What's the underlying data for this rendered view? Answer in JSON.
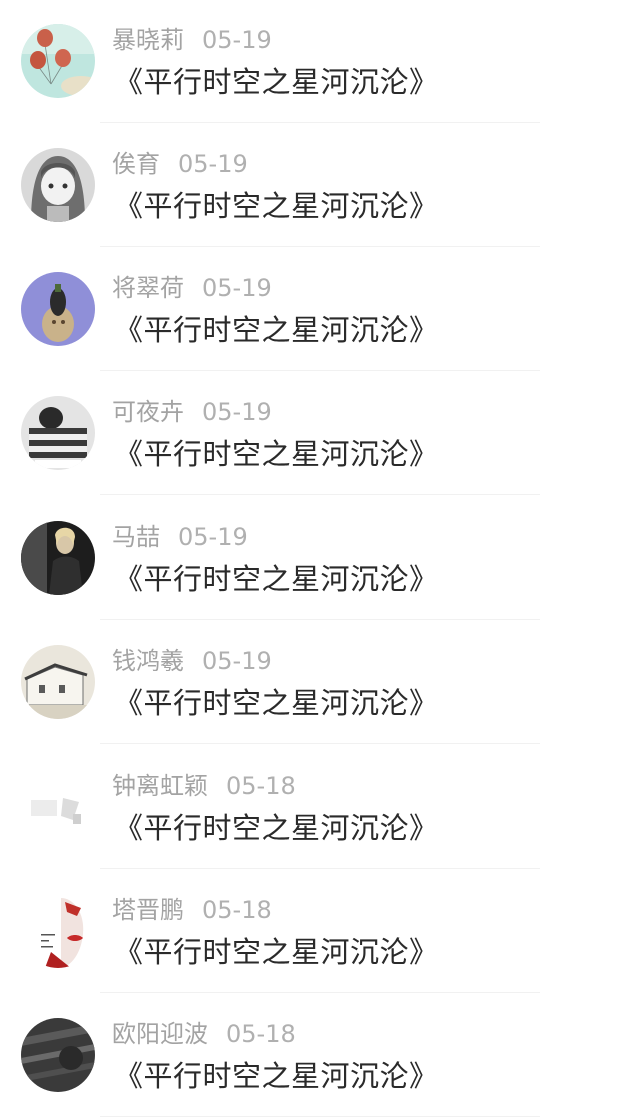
{
  "comments": [
    {
      "name": "暴晓莉",
      "date": "05-19",
      "title": "《平行时空之星河沉沦》",
      "avatar": "balloons-avatar"
    },
    {
      "name": "俟育",
      "date": "05-19",
      "title": "《平行时空之星河沉沦》",
      "avatar": "anime-girl-avatar"
    },
    {
      "name": "将翠荷",
      "date": "05-19",
      "title": "《平行时空之星河沉沦》",
      "avatar": "eggplant-avatar"
    },
    {
      "name": "可夜卉",
      "date": "05-19",
      "title": "《平行时空之星河沉沦》",
      "avatar": "striped-sweater-avatar"
    },
    {
      "name": "马喆",
      "date": "05-19",
      "title": "《平行时空之星河沉沦》",
      "avatar": "dark-portrait-avatar"
    },
    {
      "name": "钱鸿羲",
      "date": "05-19",
      "title": "《平行时空之星河沉沦》",
      "avatar": "building-avatar"
    },
    {
      "name": "钟离虹颖",
      "date": "05-18",
      "title": "《平行时空之星河沉沦》",
      "avatar": "light-abstract-avatar"
    },
    {
      "name": "塔晋鹏",
      "date": "05-18",
      "title": "《平行时空之星河沉沦》",
      "avatar": "red-lips-avatar"
    },
    {
      "name": "欧阳迎波",
      "date": "05-18",
      "title": "《平行时空之星河沉沦》",
      "avatar": "dark-texture-avatar"
    }
  ]
}
